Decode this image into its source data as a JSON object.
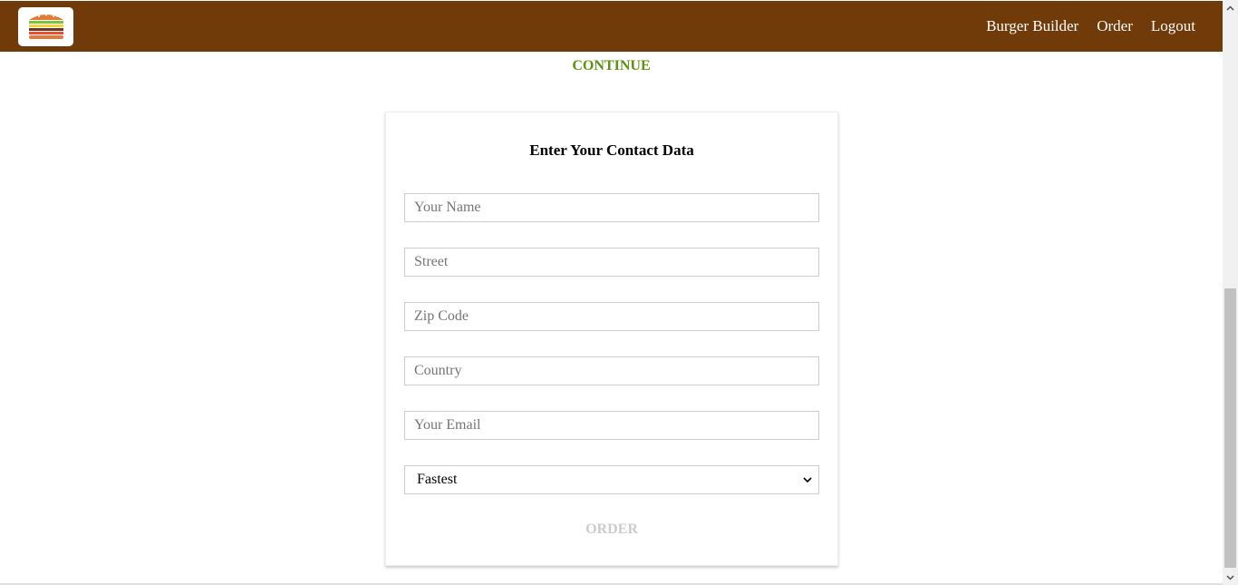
{
  "toolbar": {
    "logo_alt": "burger-logo",
    "nav": [
      {
        "label": "Burger Builder"
      },
      {
        "label": "Order"
      },
      {
        "label": "Logout"
      }
    ]
  },
  "continue_label": "CONTINUE",
  "form": {
    "title": "Enter Your Contact Data",
    "fields": [
      {
        "placeholder": "Your Name",
        "value": ""
      },
      {
        "placeholder": "Street",
        "value": ""
      },
      {
        "placeholder": "Zip Code",
        "value": ""
      },
      {
        "placeholder": "Country",
        "value": ""
      },
      {
        "placeholder": "Your Email",
        "value": ""
      }
    ],
    "delivery": {
      "selected": "Fastest"
    },
    "order_label": "ORDER"
  },
  "colors": {
    "toolbar_bg": "#703b09",
    "continue": "#5c9210",
    "order_disabled": "#cccccc"
  }
}
